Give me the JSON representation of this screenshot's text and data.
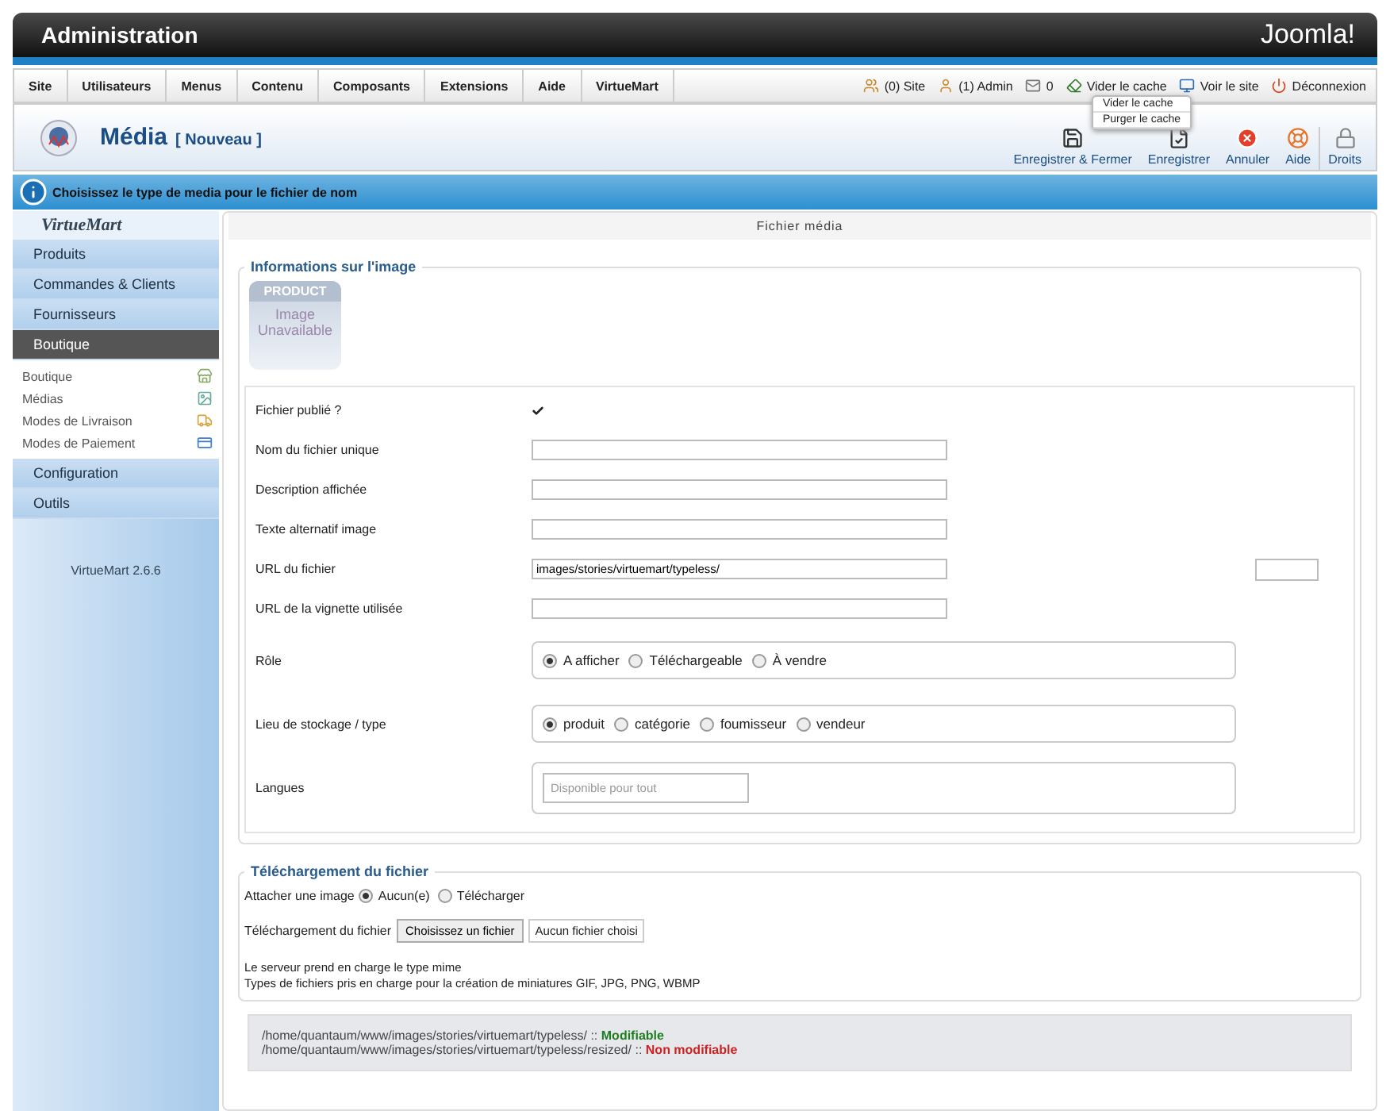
{
  "header": {
    "title": "Administration",
    "logo": "Joomla!"
  },
  "menu": [
    "Site",
    "Utilisateurs",
    "Menus",
    "Contenu",
    "Composants",
    "Extensions",
    "Aide",
    "VirtueMart"
  ],
  "status": [
    {
      "kind": "users",
      "text": "(0) Site"
    },
    {
      "kind": "admin",
      "text": "(1) Admin"
    },
    {
      "kind": "mail",
      "text": "0"
    },
    {
      "kind": "cache",
      "text": "Vider le cache"
    },
    {
      "kind": "site",
      "text": "Voir le site"
    },
    {
      "kind": "logout",
      "text": "Déconnexion"
    }
  ],
  "cache_menu": [
    "Vider le cache",
    "Purger le cache"
  ],
  "page_title": {
    "title": "Média",
    "subtitle": "[ Nouveau ]"
  },
  "toolbar": [
    {
      "kind": "save",
      "label": "Enregistrer & Fermer"
    },
    {
      "kind": "apply",
      "label": "Enregistrer"
    },
    {
      "kind": "cancel",
      "label": "Annuler"
    },
    {
      "kind": "help",
      "label": "Aide"
    },
    {
      "kind": "lock",
      "label": "Droits"
    }
  ],
  "info": "Choisissez le type de media pour le fichier de nom",
  "sidebar": {
    "logo": "VirtueMart",
    "version": "VirtueMart 2.6.6",
    "groups": [
      {
        "label": "Produits",
        "selected": false
      },
      {
        "label": "Commandes & Clients",
        "selected": false
      },
      {
        "label": "Fournisseurs",
        "selected": false
      },
      {
        "label": "Boutique",
        "selected": true,
        "children": [
          {
            "label": "Boutique",
            "kind": "shop"
          },
          {
            "label": "Médias",
            "kind": "media"
          },
          {
            "label": "Modes de Livraison",
            "kind": "truck"
          },
          {
            "label": "Modes de Paiement",
            "kind": "payment"
          }
        ]
      },
      {
        "label": "Configuration",
        "selected": false
      },
      {
        "label": "Outils",
        "selected": false
      }
    ]
  },
  "main_title": "Fichier média",
  "image_info": {
    "legend": "Informations sur l'image",
    "placeholder_top": "PRODUCT",
    "placeholder_text": "Image Unavailable",
    "fields": [
      {
        "kind": "checkbox",
        "label": "Fichier publié ?",
        "checked": true
      },
      {
        "kind": "text",
        "label": "Nom du fichier unique"
      },
      {
        "kind": "text",
        "label": "Description affichée"
      },
      {
        "kind": "text",
        "label": "Texte alternatif image"
      },
      {
        "kind": "text",
        "label": "URL du fichier",
        "value": "images/stories/virtuemart/typeless/",
        "preview": true
      },
      {
        "kind": "text",
        "label": "URL de la vignette utilisée"
      },
      {
        "kind": "radio",
        "label": "Rôle",
        "options": [
          {
            "label": "A afficher",
            "selected": true
          },
          {
            "label": "Téléchargeable",
            "selected": false
          },
          {
            "label": "À vendre",
            "selected": false
          }
        ]
      },
      {
        "kind": "radio",
        "label": "Lieu de stockage / type",
        "options": [
          {
            "label": "produit",
            "selected": true
          },
          {
            "label": "catégorie",
            "selected": false
          },
          {
            "label": "foumisseur",
            "selected": false
          },
          {
            "label": "vendeur",
            "selected": false
          }
        ]
      },
      {
        "kind": "multi",
        "label": "Langues",
        "placeholder": "Disponible pour tout"
      }
    ]
  },
  "upload": {
    "legend": "Téléchargement du fichier",
    "attach_label": "Attacher une image",
    "attach_options": [
      {
        "label": "Aucun(e)",
        "selected": true
      },
      {
        "label": "Télécharger",
        "selected": false
      }
    ],
    "file_label": "Téléchargement du fichier",
    "file_button": "Choisissez un fichier",
    "file_status": "Aucun fichier choisi",
    "notes": [
      "Le serveur prend en charge le type mime",
      "Types de fichiers pris en charge pour la création de miniatures GIF, JPG, PNG, WBMP"
    ]
  },
  "paths": [
    {
      "path": "/home/quantaum/www/images/stories/virtuemart/typeless/",
      "sep": "::",
      "status": "Modifiable",
      "writable": true
    },
    {
      "path": "/home/quantaum/www/images/stories/virtuemart/typeless/resized/",
      "sep": "::",
      "status": "Non modifiable",
      "writable": false
    }
  ]
}
